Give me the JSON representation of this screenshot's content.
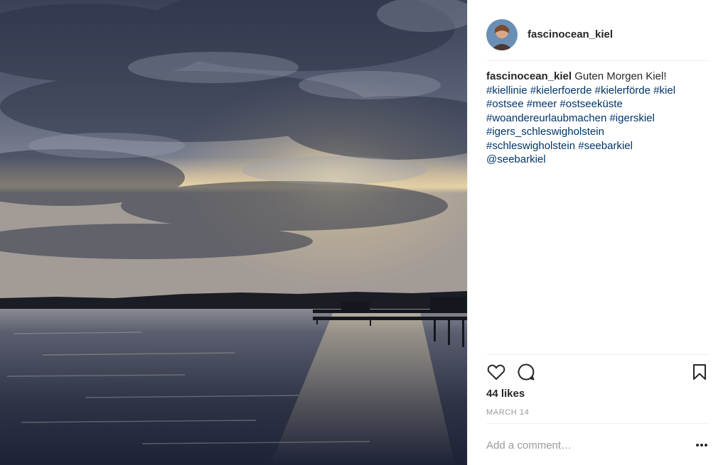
{
  "post": {
    "photo_icon": "landscape-photo",
    "username": "fascinocean_kiel",
    "caption": {
      "username": "fascinocean_kiel",
      "text": "Guten Morgen Kiel!",
      "hashtags": [
        "#kiellinie",
        "#kielerfoerde",
        "#kielerförde",
        "#kiel",
        "#ostsee",
        "#meer",
        "#ostseeküste",
        "#woandereurlaubmachen",
        "#igerskiel",
        "#igers_schleswigholstein",
        "#schleswigholstein",
        "#seebarkiel"
      ],
      "mention": "@seebarkiel"
    },
    "actions": {
      "like_icon": "heart-icon",
      "comment_icon": "comment-bubble-icon",
      "save_icon": "bookmark-icon"
    },
    "likes": "44 likes",
    "date": "MARCH 14",
    "comment": {
      "placeholder": "Add a comment…",
      "more_icon": "more-options-icon"
    }
  }
}
